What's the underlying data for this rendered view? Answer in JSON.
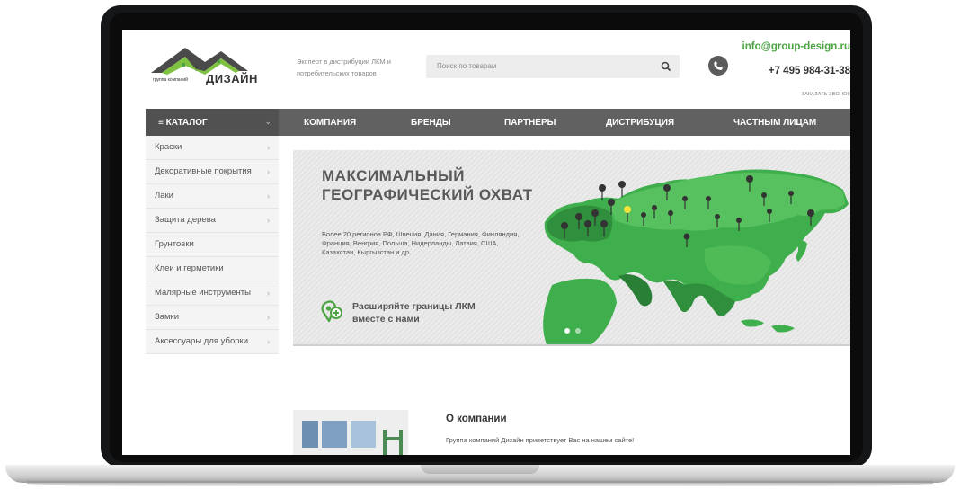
{
  "brand": {
    "logo_small": "группа компаний",
    "logo_big": "ДИЗАЙН",
    "tagline": "Эксперт в дистрибуции ЛКМ и потребительских товаров"
  },
  "search": {
    "placeholder": "Поиск по товарам"
  },
  "contacts": {
    "email": "info@group-design.ru",
    "phone": "+7 495 984-31-38",
    "callback": "ЗАКАЗАТЬ ЗВОНОК"
  },
  "nav": {
    "catalog": "≡ КАТАЛОГ",
    "items": [
      "КОМПАНИЯ",
      "БРЕНДЫ",
      "ПАРТНЕРЫ",
      "ДИСТРИБУЦИЯ",
      "ЧАСТНЫМ ЛИЦАМ"
    ]
  },
  "sidebar": {
    "items": [
      {
        "label": "Краски",
        "arrow": true
      },
      {
        "label": "Декоративные покрытия",
        "arrow": true
      },
      {
        "label": "Лаки",
        "arrow": true
      },
      {
        "label": "Защита дерева",
        "arrow": true
      },
      {
        "label": "Грунтовки",
        "arrow": false
      },
      {
        "label": "Клеи и герметики",
        "arrow": false
      },
      {
        "label": "Малярные инструменты",
        "arrow": true
      },
      {
        "label": "Замки",
        "arrow": true
      },
      {
        "label": "Аксессуары для уборки",
        "arrow": true
      }
    ]
  },
  "banner": {
    "title": "МАКСИМАЛЬНЫЙ ГЕОГРАФИЧЕСКИЙ ОХВАТ",
    "text": "Более 20 регионов РФ, Швеция, Дания, Германия, Финляндия, Франция, Венгрия, Польша, Нидерланды, Латвия, США, Казахстан, Кыргызстан и др.",
    "cta": "Расширяйте границы ЛКМ вместе с нами",
    "slides": 2,
    "active_slide": 1
  },
  "about": {
    "title": "О компании",
    "text": "Группа компаний Дизайн приветствует Вас на нашем сайте!"
  },
  "colors": {
    "accent_green": "#4ba343",
    "nav_gray": "#616161",
    "catalog_gray": "#515151",
    "map_green": "#3fae4c"
  },
  "icons": [
    "hamburger-icon",
    "search-icon",
    "phone-icon",
    "chevron-down-icon",
    "chevron-right-icon",
    "map-pin-add-icon"
  ]
}
